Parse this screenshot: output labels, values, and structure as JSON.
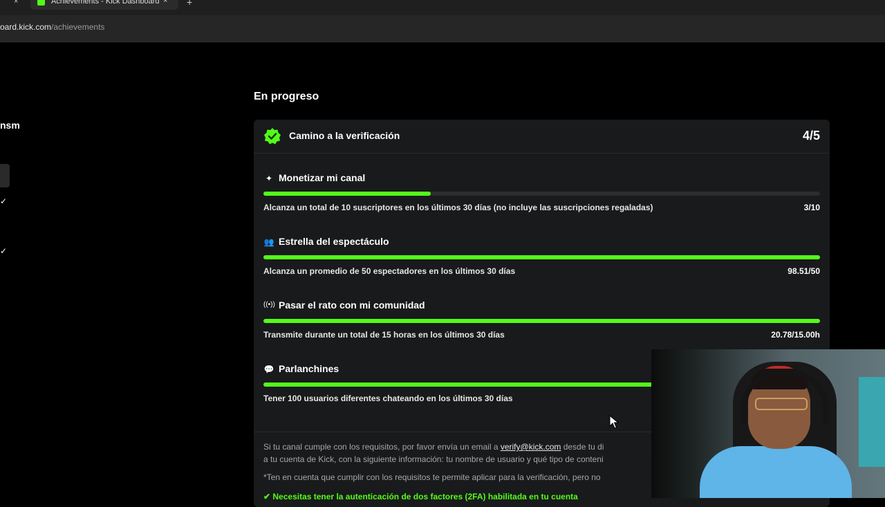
{
  "browser": {
    "tab_title": "Achievements - Kick Dashboard",
    "tab_close": "×",
    "new_tab": "+",
    "url_host": "oard.kick.com",
    "url_path": "/achievements"
  },
  "sidebar": {
    "partial_label": "nsm",
    "check_1": "✓",
    "check_2": "✓"
  },
  "main": {
    "section_title": "En progreso",
    "card": {
      "title": "Camino a la verificación",
      "count": "4/5",
      "items": [
        {
          "icon": "sparkle-icon",
          "icon_glyph": "✦",
          "title": "Monetizar mi canal",
          "description": "Alcanza un total de 10 suscriptores en los últimos 30 días (no incluye las suscripciones regaladas)",
          "value": "3/10",
          "progress": 0.3
        },
        {
          "icon": "users-icon",
          "icon_glyph": "👥",
          "title": "Estrella del espectáculo",
          "description": "Alcanza un promedio de 50 espectadores en los últimos 30 días",
          "value": "98.51/50",
          "progress": 1.0
        },
        {
          "icon": "broadcast-icon",
          "icon_glyph": "((•))",
          "title": "Pasar el rato con mi comunidad",
          "description": "Transmite durante un total de 15 horas en los últimos 30 días",
          "value": "20.78/15.00h",
          "progress": 1.0
        },
        {
          "icon": "chat-bubble-icon",
          "icon_glyph": "💬",
          "title": "Parlanchines",
          "description": "Tener 100 usuarios diferentes chateando en los últimos 30 días",
          "value": "",
          "progress": 1.0
        }
      ],
      "note_line1_pre": "Si tu canal cumple con los requisitos, por favor envía un email a ",
      "note_email": "verify@kick.com",
      "note_line1_post": " desde tu di",
      "note_line2": "a tu cuenta de Kick, con la siguiente información: tu nombre de usuario y qué tipo de conteni",
      "note_line3": "*Ten en cuenta que cumplir con los requisitos te permite aplicar para la verificación, pero no",
      "note_2fa": "✔ Necesitas tener la autenticación de dos factores (2FA) habilitada en tu cuenta"
    }
  },
  "colors": {
    "accent": "#53fc18",
    "card_bg": "#191a1c",
    "track": "#2c2d2f"
  }
}
